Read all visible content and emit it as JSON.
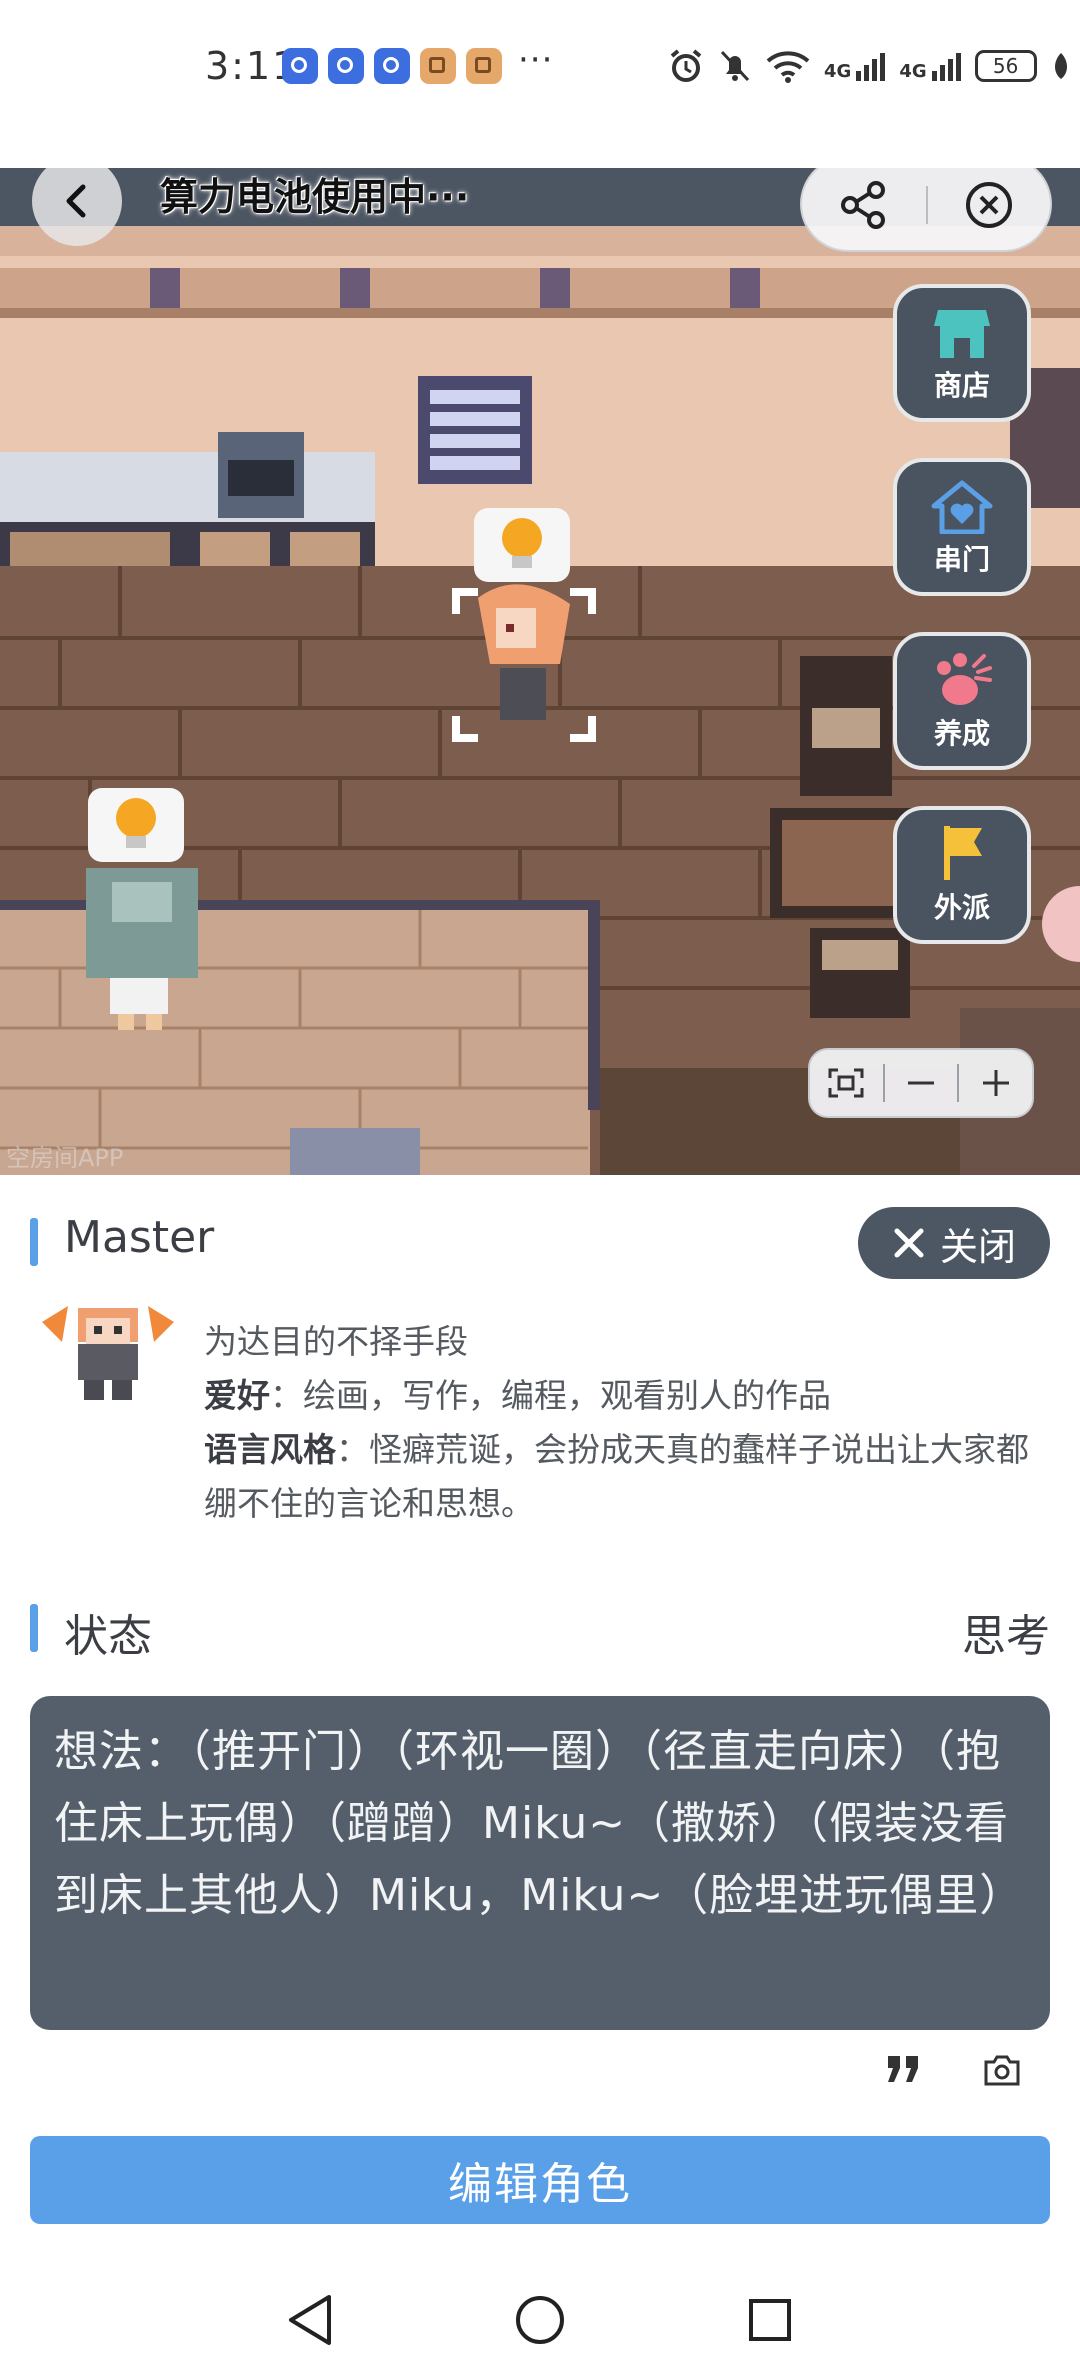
{
  "status_bar": {
    "time": "3:11",
    "more_notifications": "···",
    "network_1": "4G",
    "network_2": "4G",
    "battery": "56"
  },
  "game": {
    "title": "算力电池使用中···",
    "watermark": "空房间APP",
    "side_buttons": {
      "shop": "商店",
      "visit": "串门",
      "nurture": "养成",
      "dispatch": "外派"
    },
    "colors": {
      "shop_icon": "#4dc3c0",
      "visit_icon": "#5b9fe6",
      "nurture_icon": "#f07a8c",
      "dispatch_icon": "#f5c13a"
    }
  },
  "panel": {
    "name": "Master",
    "close_label": "关闭",
    "motto": "为达目的不择手段",
    "hobby_label": "爱好",
    "hobby_text": "：绘画，写作，编程，观看别人的作品",
    "style_label": "语言风格",
    "style_text": "：怪癖荒诞，会扮成天真的蠢样子说出让大家都绷不住的言论和思想。",
    "status_title": "状态",
    "status_value": "思考",
    "thought": "想法：（推开门）（环视一圈）（径直走向床）（抱住床上玩偶）（蹭蹭）Miku~（撒娇）（假装没看到床上其他人）Miku，Miku~（脸埋进玩偶里）",
    "edit_button": "编辑角色",
    "accent_color": "#5aa0e8"
  }
}
